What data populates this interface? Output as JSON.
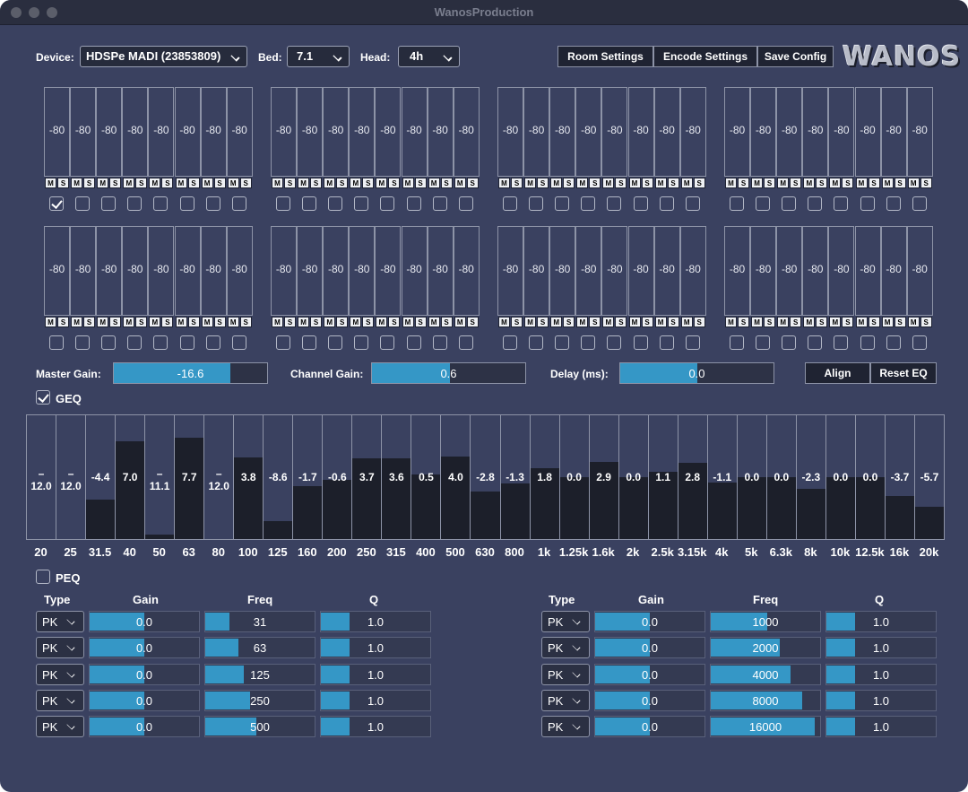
{
  "window": {
    "title": "WanosProduction"
  },
  "header": {
    "device_label": "Device:",
    "device_value": "HDSPe MADI (23853809)",
    "bed_label": "Bed:",
    "bed_value": "7.1",
    "head_label": "Head:",
    "head_value": "4h",
    "room_settings": "Room Settings",
    "encode_settings": "Encode Settings",
    "save_config": "Save Config",
    "logo": "WANOS"
  },
  "meters": {
    "groups": 8,
    "channels_per_group": 8,
    "level": "-80",
    "mute_label": "M",
    "solo_label": "S",
    "checked_channels": [
      0
    ]
  },
  "gains": {
    "master_label": "Master Gain:",
    "master_value": "-16.6",
    "master_fill": 0.76,
    "channel_label": "Channel Gain:",
    "channel_value": "0.6",
    "channel_fill": 0.51,
    "delay_label": "Delay (ms):",
    "delay_value": "0.0",
    "delay_fill": 0.5,
    "align": "Align",
    "reset_eq": "Reset EQ"
  },
  "geq": {
    "label": "GEQ",
    "enabled": true,
    "bands": [
      {
        "freq": "20",
        "gain": -12.0,
        "text": "–\n12.0"
      },
      {
        "freq": "25",
        "gain": -12.0,
        "text": "–\n12.0"
      },
      {
        "freq": "31.5",
        "gain": -4.4,
        "text": "-4.4"
      },
      {
        "freq": "40",
        "gain": 7.0,
        "text": "7.0"
      },
      {
        "freq": "50",
        "gain": -11.1,
        "text": "–\n11.1"
      },
      {
        "freq": "63",
        "gain": 7.7,
        "text": "7.7"
      },
      {
        "freq": "80",
        "gain": -12.0,
        "text": "–\n12.0"
      },
      {
        "freq": "100",
        "gain": 3.8,
        "text": "3.8"
      },
      {
        "freq": "125",
        "gain": -8.6,
        "text": "-8.6"
      },
      {
        "freq": "160",
        "gain": -1.7,
        "text": "-1.7"
      },
      {
        "freq": "200",
        "gain": -0.6,
        "text": "-0.6"
      },
      {
        "freq": "250",
        "gain": 3.7,
        "text": "3.7"
      },
      {
        "freq": "315",
        "gain": 3.6,
        "text": "3.6"
      },
      {
        "freq": "400",
        "gain": 0.5,
        "text": "0.5"
      },
      {
        "freq": "500",
        "gain": 4.0,
        "text": "4.0"
      },
      {
        "freq": "630",
        "gain": -2.8,
        "text": "-2.8"
      },
      {
        "freq": "800",
        "gain": -1.3,
        "text": "-1.3"
      },
      {
        "freq": "1k",
        "gain": 1.8,
        "text": "1.8"
      },
      {
        "freq": "1.25k",
        "gain": 0.0,
        "text": "0.0"
      },
      {
        "freq": "1.6k",
        "gain": 2.9,
        "text": "2.9"
      },
      {
        "freq": "2k",
        "gain": 0.0,
        "text": "0.0"
      },
      {
        "freq": "2.5k",
        "gain": 1.1,
        "text": "1.1"
      },
      {
        "freq": "3.15k",
        "gain": 2.8,
        "text": "2.8"
      },
      {
        "freq": "4k",
        "gain": -1.1,
        "text": "-1.1"
      },
      {
        "freq": "5k",
        "gain": 0.0,
        "text": "0.0"
      },
      {
        "freq": "6.3k",
        "gain": 0.0,
        "text": "0.0"
      },
      {
        "freq": "8k",
        "gain": -2.3,
        "text": "-2.3"
      },
      {
        "freq": "10k",
        "gain": 0.0,
        "text": "0.0"
      },
      {
        "freq": "12.5k",
        "gain": 0.0,
        "text": "0.0"
      },
      {
        "freq": "16k",
        "gain": -3.7,
        "text": "-3.7"
      },
      {
        "freq": "20k",
        "gain": -5.7,
        "text": "-5.7"
      }
    ]
  },
  "peq": {
    "label": "PEQ",
    "enabled": false,
    "headers": {
      "type": "Type",
      "gain": "Gain",
      "freq": "Freq",
      "q": "Q"
    },
    "left": [
      {
        "type": "PK",
        "gain": "0.0",
        "freq": "31",
        "freq_fill": 0.22,
        "q": "1.0"
      },
      {
        "type": "PK",
        "gain": "0.0",
        "freq": "63",
        "freq_fill": 0.3,
        "q": "1.0"
      },
      {
        "type": "PK",
        "gain": "0.0",
        "freq": "125",
        "freq_fill": 0.35,
        "q": "1.0"
      },
      {
        "type": "PK",
        "gain": "0.0",
        "freq": "250",
        "freq_fill": 0.41,
        "q": "1.0"
      },
      {
        "type": "PK",
        "gain": "0.0",
        "freq": "500",
        "freq_fill": 0.47,
        "q": "1.0"
      }
    ],
    "right": [
      {
        "type": "PK",
        "gain": "0.0",
        "freq": "1000",
        "freq_fill": 0.52,
        "q": "1.0"
      },
      {
        "type": "PK",
        "gain": "0.0",
        "freq": "2000",
        "freq_fill": 0.63,
        "q": "1.0"
      },
      {
        "type": "PK",
        "gain": "0.0",
        "freq": "4000",
        "freq_fill": 0.73,
        "q": "1.0"
      },
      {
        "type": "PK",
        "gain": "0.0",
        "freq": "8000",
        "freq_fill": 0.84,
        "q": "1.0"
      },
      {
        "type": "PK",
        "gain": "0.0",
        "freq": "16000",
        "freq_fill": 0.95,
        "q": "1.0"
      }
    ],
    "gain_fill": 0.5,
    "q_fill": 0.26
  }
}
